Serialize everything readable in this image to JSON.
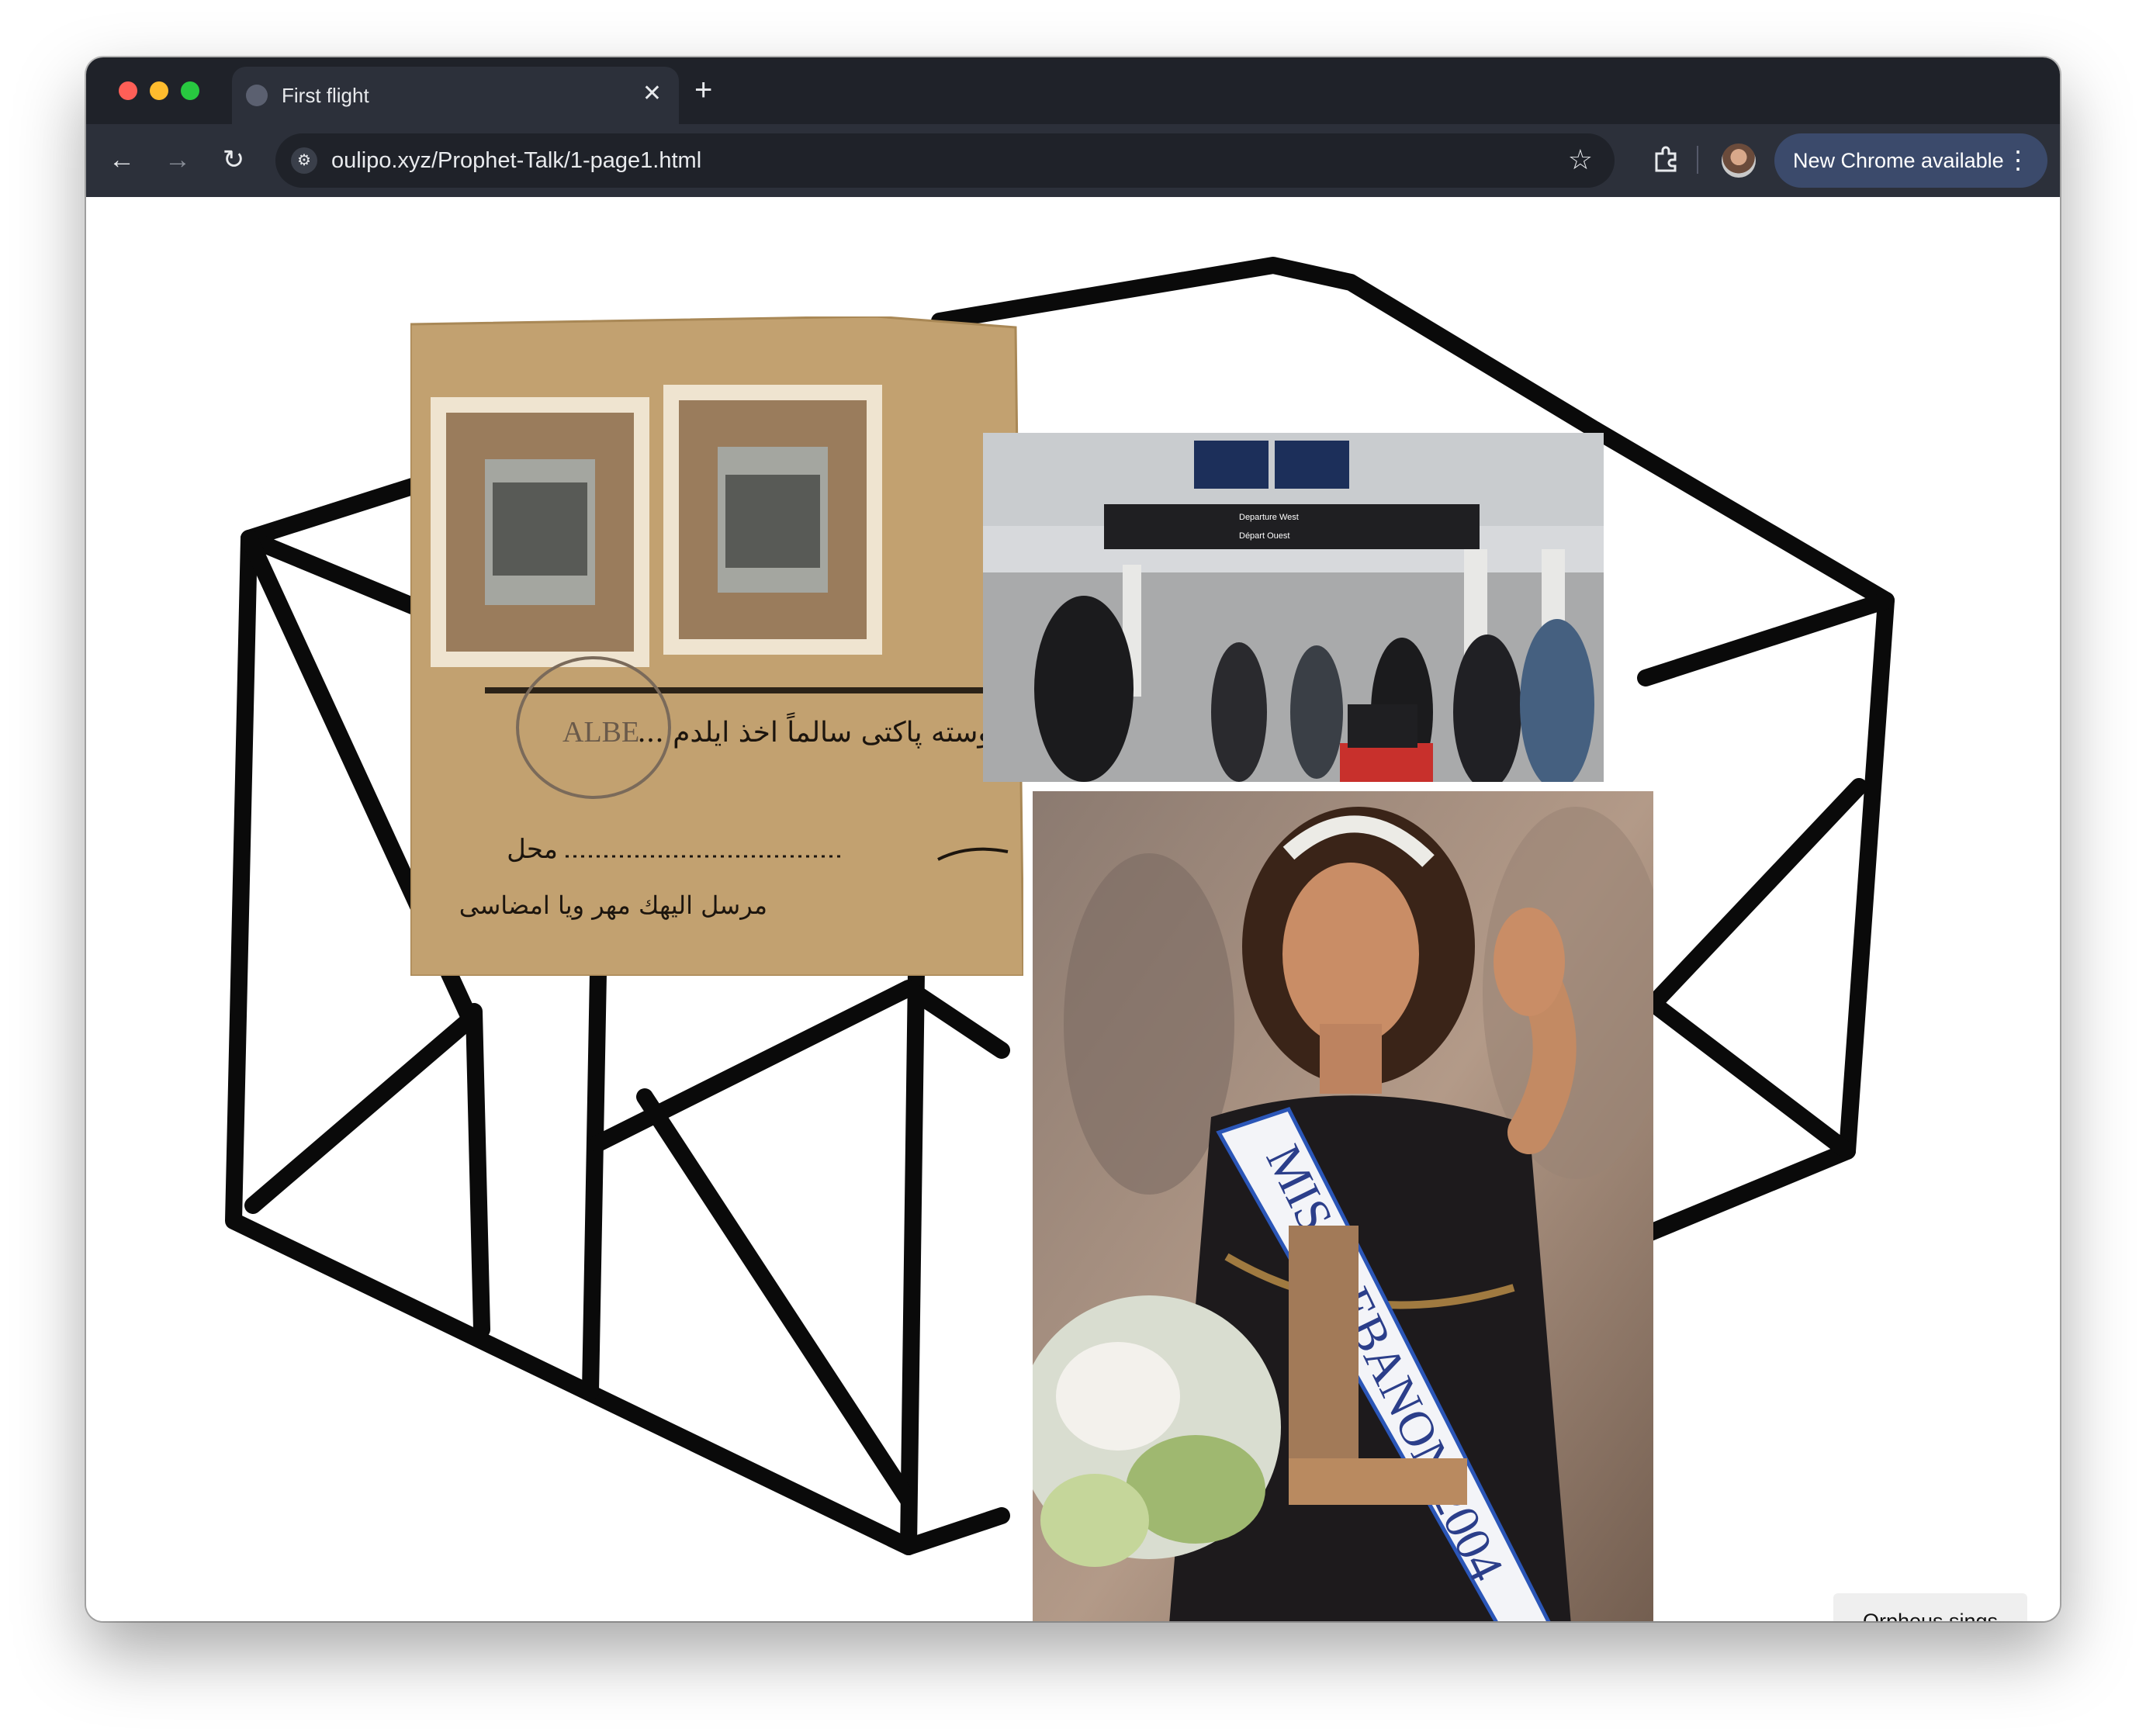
{
  "browser": {
    "tab": {
      "title": "First flight",
      "close_glyph": "✕"
    },
    "new_tab_glyph": "+",
    "nav": {
      "back_glyph": "←",
      "forward_glyph": "→",
      "reload_glyph": "↻"
    },
    "address_bar": {
      "url": "oulipo.xyz/Prophet-Talk/1-page1.html",
      "bookmark_glyph": "☆"
    },
    "update_banner": {
      "label": "New Chrome available",
      "menu_glyph": "⋮"
    }
  },
  "page": {
    "images": {
      "stamp": {
        "description_icon": "ottoman-stamps-postal-fragment",
        "arabic_lines": [
          "... پوسته پاکتی سالماً اخذ ایلدم",
          "محل",
          "مرسل الیهك مهر ویا امضاسی"
        ],
        "postmark_text": "ALBE"
      },
      "airport": {
        "sign_labels": [
          "Departure West",
          "Départ Ouest"
        ]
      },
      "pageant": {
        "sash_text": "MISS LEBANON 2004"
      }
    },
    "button": {
      "label": "Orpheus sings"
    }
  }
}
